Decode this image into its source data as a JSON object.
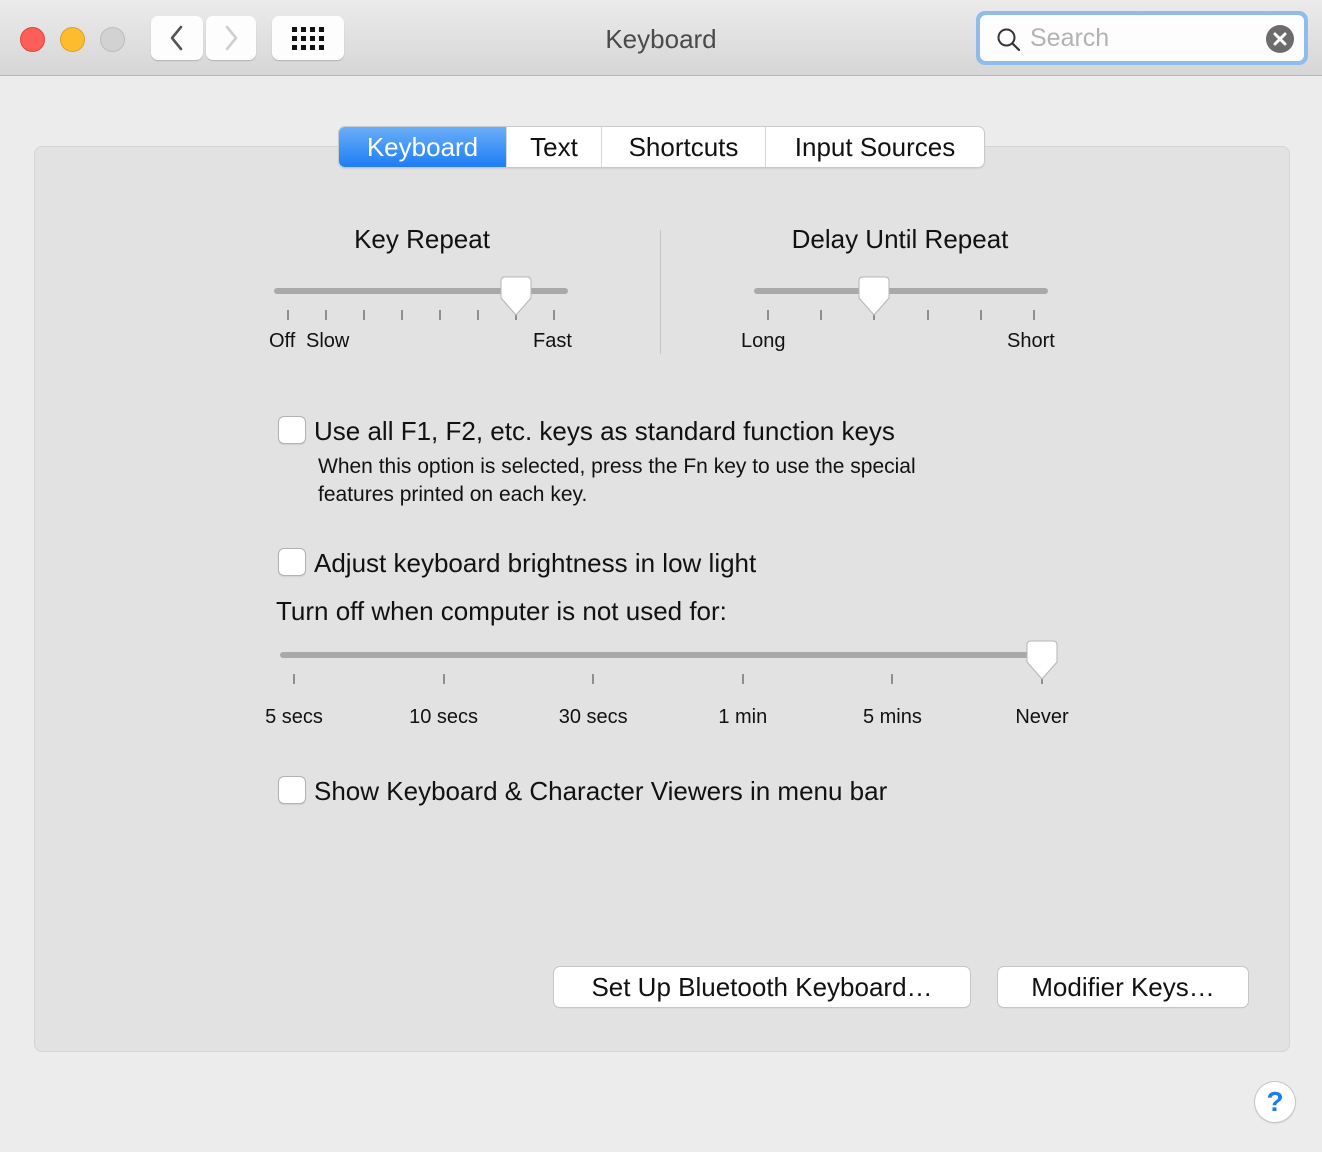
{
  "window": {
    "title": "Keyboard",
    "traffic_lights": [
      "close",
      "minimize",
      "zoom"
    ],
    "nav": {
      "back_icon": "chevron-left-icon",
      "forward_icon": "chevron-right-icon",
      "show_all_icon": "grid-icon"
    },
    "search": {
      "placeholder": "Search",
      "value": "",
      "icon": "search-icon",
      "clear_icon": "clear-icon"
    }
  },
  "tabs": [
    {
      "label": "Keyboard",
      "active": true
    },
    {
      "label": "Text",
      "active": false
    },
    {
      "label": "Shortcuts",
      "active": false
    },
    {
      "label": "Input Sources",
      "active": false
    }
  ],
  "key_repeat": {
    "title": "Key Repeat",
    "min_label": "Off",
    "slow_label": "Slow",
    "max_label": "Fast",
    "tick_count": 8,
    "value_index": 6
  },
  "delay_until_repeat": {
    "title": "Delay Until Repeat",
    "min_label": "Long",
    "max_label": "Short",
    "tick_count": 6,
    "value_index": 2
  },
  "options": {
    "function_keys": {
      "label": "Use all F1, F2, etc. keys as standard function keys",
      "checked": false,
      "help_line1": "When this option is selected, press the Fn key to use the special",
      "help_line2": "features printed on each key."
    },
    "brightness": {
      "label": "Adjust keyboard brightness in low light",
      "checked": false
    },
    "turn_off_label": "Turn off when computer is not used for:",
    "show_viewers": {
      "label": "Show Keyboard & Character Viewers in menu bar",
      "checked": false
    }
  },
  "backlight_timeout": {
    "ticks": [
      "5 secs",
      "10 secs",
      "30 secs",
      "1 min",
      "5 mins",
      "Never"
    ],
    "value_index": 5
  },
  "buttons": {
    "bluetooth": "Set Up Bluetooth Keyboard…",
    "modifier": "Modifier Keys…",
    "help": "?"
  },
  "colors": {
    "accent": "#1d7ef6",
    "help": "#1c7cf4"
  }
}
